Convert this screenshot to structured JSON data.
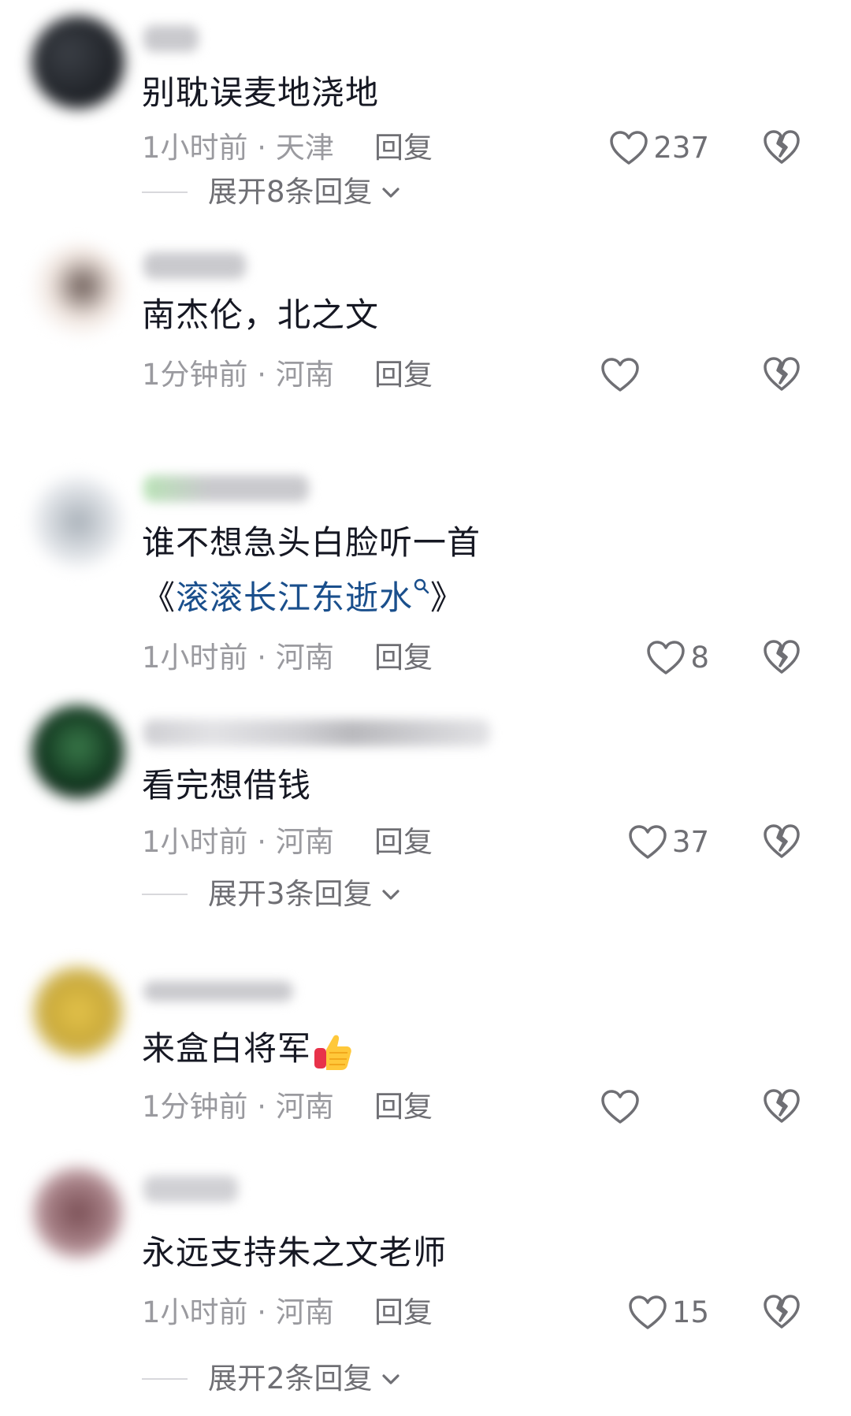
{
  "comments": [
    {
      "text": "别耽误麦地浇地",
      "time": "1小时前",
      "location": "天津",
      "reply_label": "回复",
      "likes": "237",
      "expand_label": "展开8条回复"
    },
    {
      "text": "南杰伦，北之文",
      "time": "1分钟前",
      "location": "河南",
      "reply_label": "回复",
      "likes": ""
    },
    {
      "text": "谁不想急头白脸听一首",
      "text_line2_open": "《",
      "song_link": "滚滚长江东逝水",
      "text_line2_close": "》",
      "time": "1小时前",
      "location": "河南",
      "reply_label": "回复",
      "likes": "8"
    },
    {
      "text": "看完想借钱",
      "time": "1小时前",
      "location": "河南",
      "reply_label": "回复",
      "likes": "37",
      "expand_label": "展开3条回复"
    },
    {
      "text": "来盒白将军",
      "time": "1分钟前",
      "location": "河南",
      "reply_label": "回复",
      "likes": "",
      "emoji": "thumbs-up-emoji"
    },
    {
      "text": "永远支持朱之文老师",
      "time": "1小时前",
      "location": "河南",
      "reply_label": "回复",
      "likes": "15",
      "expand_label": "展开2条回复"
    }
  ],
  "meta_separator": " · ",
  "colors": {
    "text": "#161823",
    "meta": "#9a9a9f",
    "action": "#6f6f74",
    "link": "#1a4f8c"
  },
  "icons": {
    "like": "heart-icon",
    "dislike": "broken-heart-icon",
    "expand": "chevron-down-icon",
    "search": "search-icon"
  }
}
